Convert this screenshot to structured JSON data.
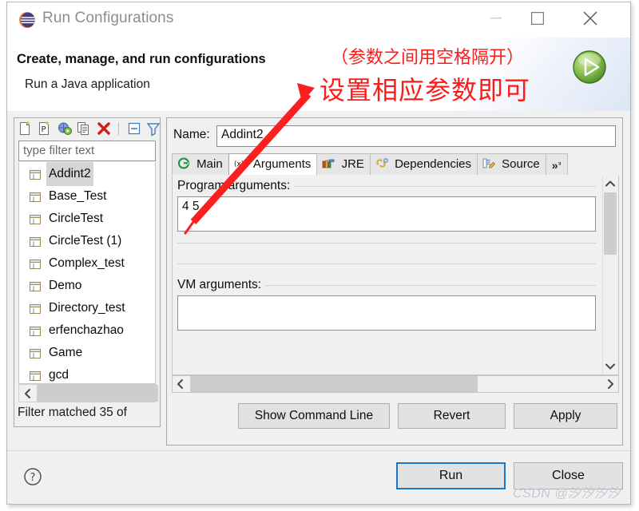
{
  "window": {
    "title": "Run Configurations",
    "icon": "eclipse-icon",
    "controls": {
      "minimize": "minimize-icon",
      "maximize": "maximize-icon",
      "close": "close-icon"
    }
  },
  "header": {
    "title": "Create, manage, and run configurations",
    "subtitle": "Run a Java application",
    "badge_icon": "green-run-icon"
  },
  "left_panel": {
    "toolbar": [
      {
        "name": "new-launch-configuration-icon"
      },
      {
        "name": "new-prototype-icon"
      },
      {
        "name": "new-configuration-from-icon"
      },
      {
        "name": "duplicate-icon"
      },
      {
        "name": "delete-icon"
      },
      {
        "name": "collapse-all-icon"
      },
      {
        "name": "filter-icon"
      },
      {
        "name": "view-menu-chevron-icon"
      }
    ],
    "filter": {
      "placeholder": "type filter text",
      "value": ""
    },
    "tree_items": [
      {
        "label": "Addint2",
        "selected": true
      },
      {
        "label": "Base_Test",
        "selected": false
      },
      {
        "label": "CircleTest",
        "selected": false
      },
      {
        "label": "CircleTest (1)",
        "selected": false
      },
      {
        "label": "Complex_test",
        "selected": false
      },
      {
        "label": "Demo",
        "selected": false
      },
      {
        "label": "Directory_test",
        "selected": false
      },
      {
        "label": "erfenchazhao",
        "selected": false
      },
      {
        "label": "Game",
        "selected": false
      },
      {
        "label": "gcd",
        "selected": false
      }
    ],
    "status": "Filter matched 35 of"
  },
  "right_panel": {
    "name_label": "Name:",
    "name_value": "Addint2",
    "tabs": [
      {
        "label": "Main",
        "icon": "main-tab-icon",
        "active": false
      },
      {
        "label": "Arguments",
        "icon": "arguments-tab-icon",
        "active": true
      },
      {
        "label": "JRE",
        "icon": "jre-tab-icon",
        "active": false
      },
      {
        "label": "Dependencies",
        "icon": "dependencies-tab-icon",
        "active": false
      },
      {
        "label": "Source",
        "icon": "source-tab-icon",
        "active": false
      }
    ],
    "tab_overflow": "»",
    "program_arguments": {
      "label": "Program arguments:",
      "value": "4 5"
    },
    "vm_arguments": {
      "label": "VM arguments:",
      "value": ""
    },
    "buttons": {
      "show_command_line": "Show Command Line",
      "revert": "Revert",
      "apply": "Apply"
    }
  },
  "footer": {
    "help_icon": "help-icon",
    "run": "Run",
    "close": "Close",
    "watermark": "CSDN @汐汐汐汐"
  },
  "annotations": {
    "note_1": "（参数之间用空格隔开）",
    "note_2": "设置相应参数即可",
    "arrow_color": "#fc1f1f"
  }
}
